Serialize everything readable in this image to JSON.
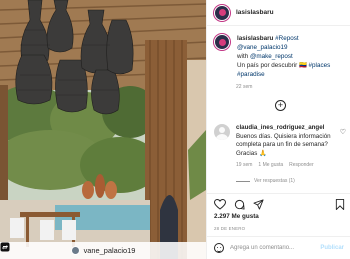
{
  "post": {
    "username": "lasislasbaru",
    "caption": {
      "username": "lasislasbaru",
      "hashtag_repost": "#Repost",
      "mention_1": "@vane_palacio19",
      "with_text": "with",
      "mention_2": "@make_repost",
      "body_text": "Un país por descubrir",
      "emoji": "🇨🇴",
      "hashtag_places": "#places",
      "hashtag_paradise": "#paradise",
      "time": "22 sem"
    },
    "comment": {
      "username": "claudia_ines_rodriguez_angel",
      "text": "Buenos días. Quisiera información completa para un fin de semana? Gracias",
      "emoji": "🙏",
      "time": "19 sem",
      "likes": "1 Me gusta",
      "reply_label": "Responder",
      "view_replies": "Ver respuestas (1)"
    },
    "likes_count": "2.297 Me gusta",
    "date": "28 DE ENERO",
    "add_comment_placeholder": "Agrega un comentario...",
    "publish_label": "Publicar",
    "repost_user": "vane_palacio19"
  },
  "icons": {
    "like": "heart-icon",
    "comment": "comment-icon",
    "share": "share-icon",
    "save": "bookmark-icon",
    "emoji": "emoji-icon",
    "load_more": "plus-circle-icon",
    "repost": "repost-icon"
  },
  "colors": {
    "hashtag": "#00376b",
    "secondary_text": "#8e8e8e",
    "publish_disabled": "#b2dffc",
    "avatar_ring": "#c13584"
  }
}
